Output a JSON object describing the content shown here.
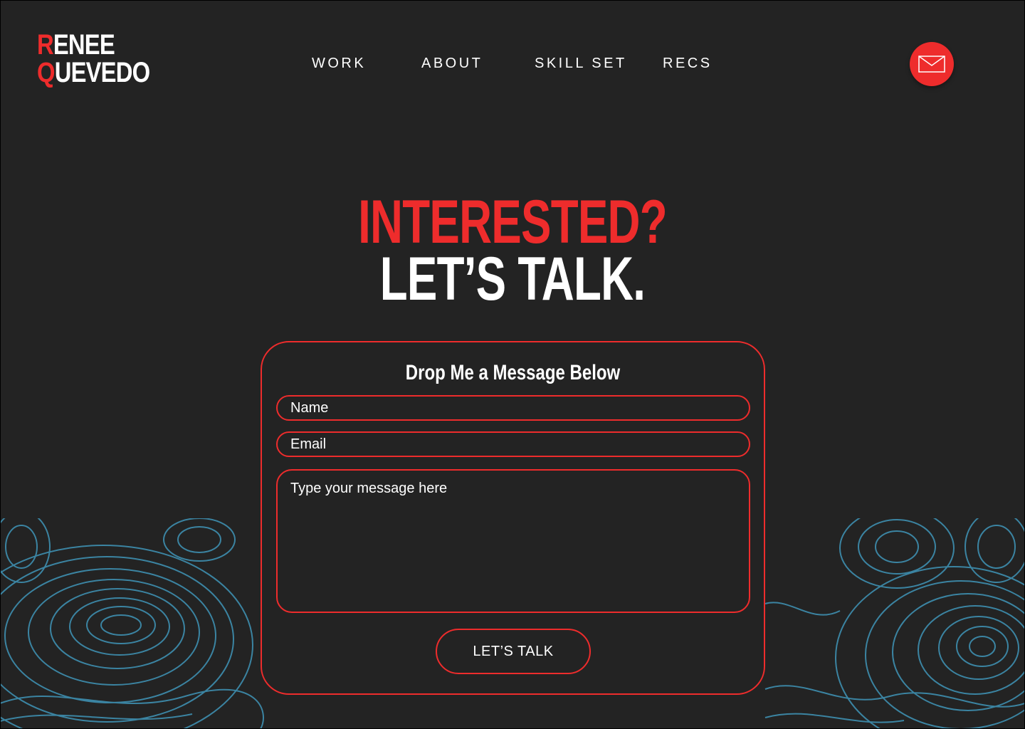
{
  "brand": {
    "first_initial": "R",
    "first_rest": "ENEE",
    "last_initial": "Q",
    "last_rest": "UEVEDO"
  },
  "nav": {
    "items": [
      {
        "label": "WORK"
      },
      {
        "label": "ABOUT"
      },
      {
        "label": "SKILL SET"
      },
      {
        "label": "RECS"
      }
    ]
  },
  "mail_button": {
    "icon": "envelope-icon"
  },
  "hero": {
    "line1": "INTERESTED?",
    "line2": "LET’S TALK."
  },
  "form": {
    "title": "Drop Me a Message Below",
    "name_placeholder": "Name",
    "email_placeholder": "Email",
    "message_placeholder": "Type your message here",
    "submit_label": "LET’S TALK"
  },
  "colors": {
    "background": "#232323",
    "accent": "#ee2c2c",
    "text": "#ffffff",
    "topo_lines": "#3e8fb0"
  }
}
